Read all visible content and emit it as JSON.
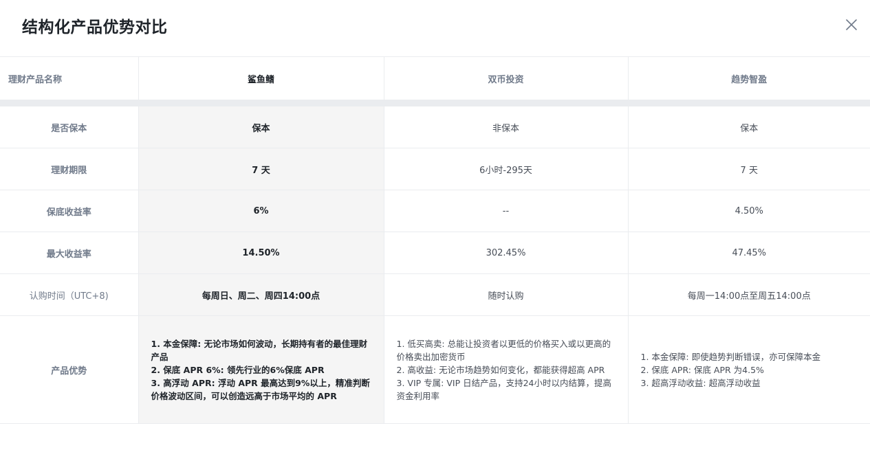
{
  "modal": {
    "title": "结构化产品优势对比"
  },
  "table": {
    "headers": [
      "理财产品名称",
      "鲨鱼鳍",
      "双币投资",
      "趋势智盈"
    ],
    "rows": [
      {
        "label": "是否保本",
        "values": [
          "保本",
          "非保本",
          "保本"
        ]
      },
      {
        "label": "理财期限",
        "values": [
          "7 天",
          "6小时-295天",
          "7 天"
        ]
      },
      {
        "label": "保底收益率",
        "values": [
          "6%",
          "--",
          "4.50%"
        ]
      },
      {
        "label": "最大收益率",
        "values": [
          "14.50%",
          "302.45%",
          "47.45%"
        ]
      },
      {
        "label": "认购时间（UTC+8)",
        "values": [
          "每周日、周二、周四14:00点",
          "随时认购",
          "每周一14:00点至周五14:00点"
        ]
      }
    ],
    "advantages": {
      "label": "产品优势",
      "col1": [
        "1. 本金保障: 无论市场如何波动，长期持有者的最佳理财产品",
        "2. 保底 APR 6%: 领先行业的6%保底 APR",
        "3. 高浮动 APR: 浮动 APR 最高达到9%以上，精准判断价格波动区间，可以创造远高于市场平均的 APR"
      ],
      "col2": [
        "1. 低买高卖: 总能让投资者以更低的价格买入或以更高的价格卖出加密货币",
        "2. 高收益: 无论市场趋势如何变化，都能获得超高 APR",
        "3. VIP 专属: VIP 日结产品，支持24小时以内结算，提高资金利用率"
      ],
      "col3": [
        "1. 本金保障: 即使趋势判断错误，亦可保障本金",
        "2. 保底 APR: 保底 APR 为4.5%",
        "3. 超高浮动收益: 超高浮动收益"
      ]
    }
  },
  "icons": {
    "close": "close-icon"
  },
  "colors": {
    "highlight_bg": "#f5f5f5",
    "separator": "#eaecef",
    "label_text": "#707a8a",
    "primary_text": "#1e2329"
  }
}
